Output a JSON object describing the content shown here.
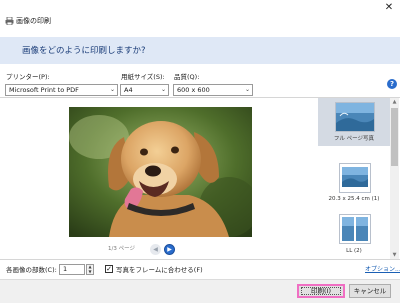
{
  "window": {
    "title": "画像の印刷",
    "close_glyph": "✕"
  },
  "banner": {
    "heading": "画像をどのように印刷しますか?"
  },
  "settings": {
    "printer_label": "プリンター(P):",
    "printer_value": "Microsoft Print to PDF",
    "paper_size_label": "用紙サイズ(S):",
    "paper_size_value": "A4",
    "quality_label": "品質(Q):",
    "quality_value": "600 x 600",
    "help_glyph": "?"
  },
  "preview": {
    "page_indicator": "1/3 ページ",
    "prev_glyph": "◀",
    "next_glyph": "▶"
  },
  "layouts": {
    "items": [
      {
        "label": "フル ページ写真",
        "selected": true
      },
      {
        "label": "20.3 x 25.4 cm (1)",
        "selected": false
      },
      {
        "label": "LL (2)",
        "selected": false
      }
    ]
  },
  "bottom": {
    "copies_label": "各画像の部数(C):",
    "copies_value": "1",
    "fit_frame_label": "写真をフレームに合わせる(F)",
    "fit_frame_checked": true,
    "options_link": "オプション..."
  },
  "footer": {
    "print_button": "印刷(I)",
    "cancel_button": "キャンセル"
  },
  "colors": {
    "banner_bg": "#dfe8f6",
    "banner_text": "#1a3c78",
    "accent_blue": "#2a6ccc",
    "focus_highlight": "#f06fc3"
  },
  "icons": {
    "title_icon": "printer-icon",
    "help_icon": "help-icon",
    "close_icon": "close-icon"
  }
}
